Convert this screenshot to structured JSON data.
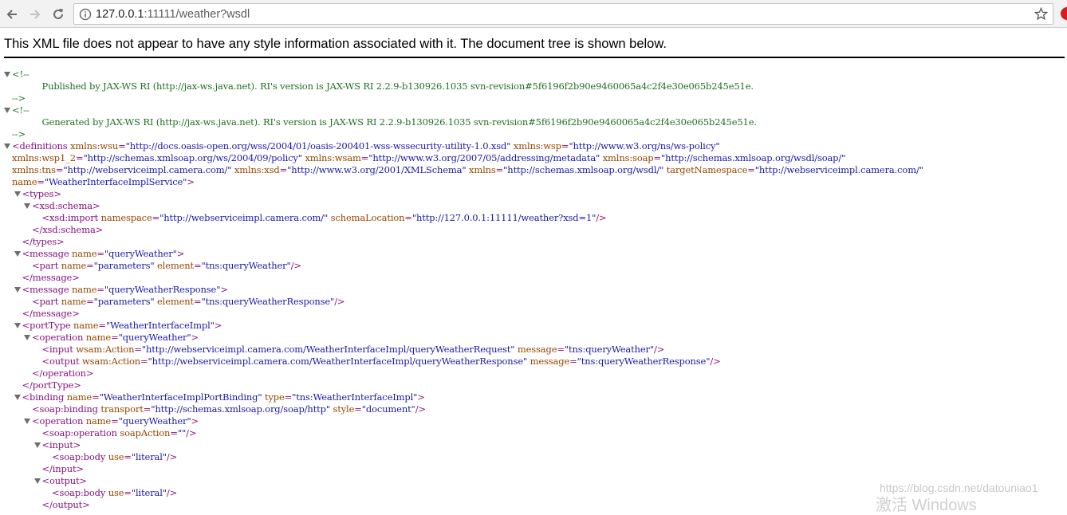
{
  "browser": {
    "url_host": "127.0.0.1",
    "url_rest": ":11111/weather?wsdl",
    "icons": {
      "back": "back-arrow-icon",
      "forward": "forward-arrow-icon",
      "reload": "reload-icon",
      "info": "page-info-icon",
      "bookmark": "bookmark-star-icon",
      "extension": "extension-icon"
    }
  },
  "banner": "This XML file does not appear to have any style information associated with it. The document tree is shown below.",
  "colors": {
    "comment": "#236e25",
    "tag": "#881280",
    "attr_name": "#994500",
    "attr_value": "#1a1aa6"
  },
  "tree": [
    {
      "indent": 0,
      "toggle": true,
      "parts": [
        {
          "c": "comment",
          "t": "<!--"
        }
      ]
    },
    {
      "indent": 3,
      "toggle": false,
      "parts": [
        {
          "c": "comment",
          "t": "Published by JAX-WS RI (http://jax-ws.java.net). RI's version is JAX-WS RI 2.2.9-b130926.1035 svn-revision#5f6196f2b90e9460065a4c2f4e30e065b245e51e."
        }
      ]
    },
    {
      "indent": 0,
      "toggle": false,
      "parts": [
        {
          "c": "comment",
          "t": "-->"
        }
      ]
    },
    {
      "indent": 0,
      "toggle": true,
      "parts": [
        {
          "c": "comment",
          "t": "<!--"
        }
      ]
    },
    {
      "indent": 3,
      "toggle": false,
      "parts": [
        {
          "c": "comment",
          "t": "Generated by JAX-WS RI (http://jax-ws.java.net). RI's version is JAX-WS RI 2.2.9-b130926.1035 svn-revision#5f6196f2b90e9460065a4c2f4e30e065b245e51e."
        }
      ]
    },
    {
      "indent": 0,
      "toggle": false,
      "parts": [
        {
          "c": "comment",
          "t": "-->"
        }
      ]
    },
    {
      "indent": 0,
      "toggle": true,
      "parts": [
        {
          "c": "tag",
          "t": "<definitions "
        },
        {
          "c": "attr",
          "t": "xmlns:wsu"
        },
        {
          "c": "tag",
          "t": "="
        },
        {
          "c": "val",
          "t": "\"http://docs.oasis-open.org/wss/2004/01/oasis-200401-wss-wssecurity-utility-1.0.xsd\""
        },
        {
          "c": "tag",
          "t": " "
        },
        {
          "c": "attr",
          "t": "xmlns:wsp"
        },
        {
          "c": "tag",
          "t": "="
        },
        {
          "c": "val",
          "t": "\"http://www.w3.org/ns/ws-policy\""
        }
      ]
    },
    {
      "indent": 0,
      "toggle": false,
      "parts": [
        {
          "c": "attr",
          "t": "xmlns:wsp1_2"
        },
        {
          "c": "tag",
          "t": "="
        },
        {
          "c": "val",
          "t": "\"http://schemas.xmlsoap.org/ws/2004/09/policy\""
        },
        {
          "c": "tag",
          "t": " "
        },
        {
          "c": "attr",
          "t": "xmlns:wsam"
        },
        {
          "c": "tag",
          "t": "="
        },
        {
          "c": "val",
          "t": "\"http://www.w3.org/2007/05/addressing/metadata\""
        },
        {
          "c": "tag",
          "t": " "
        },
        {
          "c": "attr",
          "t": "xmlns:soap"
        },
        {
          "c": "tag",
          "t": "="
        },
        {
          "c": "val",
          "t": "\"http://schemas.xmlsoap.org/wsdl/soap/\""
        }
      ]
    },
    {
      "indent": 0,
      "toggle": false,
      "parts": [
        {
          "c": "attr",
          "t": "xmlns:tns"
        },
        {
          "c": "tag",
          "t": "="
        },
        {
          "c": "val",
          "t": "\"http://webserviceimpl.camera.com/\""
        },
        {
          "c": "tag",
          "t": " "
        },
        {
          "c": "attr",
          "t": "xmlns:xsd"
        },
        {
          "c": "tag",
          "t": "="
        },
        {
          "c": "val",
          "t": "\"http://www.w3.org/2001/XMLSchema\""
        },
        {
          "c": "tag",
          "t": " "
        },
        {
          "c": "attr",
          "t": "xmlns"
        },
        {
          "c": "tag",
          "t": "="
        },
        {
          "c": "val",
          "t": "\"http://schemas.xmlsoap.org/wsdl/\""
        },
        {
          "c": "tag",
          "t": " "
        },
        {
          "c": "attr",
          "t": "targetNamespace"
        },
        {
          "c": "tag",
          "t": "="
        },
        {
          "c": "val",
          "t": "\"http://webserviceimpl.camera.com/\""
        }
      ]
    },
    {
      "indent": 0,
      "toggle": false,
      "parts": [
        {
          "c": "attr",
          "t": "name"
        },
        {
          "c": "tag",
          "t": "="
        },
        {
          "c": "val",
          "t": "\"WeatherInterfaceImplService\""
        },
        {
          "c": "tag",
          "t": ">"
        }
      ]
    },
    {
      "indent": 1,
      "toggle": true,
      "parts": [
        {
          "c": "tag",
          "t": "<types>"
        }
      ]
    },
    {
      "indent": 2,
      "toggle": true,
      "parts": [
        {
          "c": "tag",
          "t": "<xsd:schema>"
        }
      ]
    },
    {
      "indent": 3,
      "toggle": false,
      "parts": [
        {
          "c": "tag",
          "t": "<xsd:import "
        },
        {
          "c": "attr",
          "t": "namespace"
        },
        {
          "c": "tag",
          "t": "="
        },
        {
          "c": "val",
          "t": "\"http://webserviceimpl.camera.com/\""
        },
        {
          "c": "tag",
          "t": " "
        },
        {
          "c": "attr",
          "t": "schemaLocation"
        },
        {
          "c": "tag",
          "t": "="
        },
        {
          "c": "val",
          "t": "\"http://127.0.0.1:11111/weather?xsd=1\""
        },
        {
          "c": "tag",
          "t": "/>"
        }
      ]
    },
    {
      "indent": 2,
      "toggle": false,
      "parts": [
        {
          "c": "tag",
          "t": "</xsd:schema>"
        }
      ]
    },
    {
      "indent": 1,
      "toggle": false,
      "parts": [
        {
          "c": "tag",
          "t": "</types>"
        }
      ]
    },
    {
      "indent": 1,
      "toggle": true,
      "parts": [
        {
          "c": "tag",
          "t": "<message "
        },
        {
          "c": "attr",
          "t": "name"
        },
        {
          "c": "tag",
          "t": "="
        },
        {
          "c": "val",
          "t": "\"queryWeather\""
        },
        {
          "c": "tag",
          "t": ">"
        }
      ]
    },
    {
      "indent": 2,
      "toggle": false,
      "parts": [
        {
          "c": "tag",
          "t": "<part "
        },
        {
          "c": "attr",
          "t": "name"
        },
        {
          "c": "tag",
          "t": "="
        },
        {
          "c": "val",
          "t": "\"parameters\""
        },
        {
          "c": "tag",
          "t": " "
        },
        {
          "c": "attr",
          "t": "element"
        },
        {
          "c": "tag",
          "t": "="
        },
        {
          "c": "val",
          "t": "\"tns:queryWeather\""
        },
        {
          "c": "tag",
          "t": "/>"
        }
      ]
    },
    {
      "indent": 1,
      "toggle": false,
      "parts": [
        {
          "c": "tag",
          "t": "</message>"
        }
      ]
    },
    {
      "indent": 1,
      "toggle": true,
      "parts": [
        {
          "c": "tag",
          "t": "<message "
        },
        {
          "c": "attr",
          "t": "name"
        },
        {
          "c": "tag",
          "t": "="
        },
        {
          "c": "val",
          "t": "\"queryWeatherResponse\""
        },
        {
          "c": "tag",
          "t": ">"
        }
      ]
    },
    {
      "indent": 2,
      "toggle": false,
      "parts": [
        {
          "c": "tag",
          "t": "<part "
        },
        {
          "c": "attr",
          "t": "name"
        },
        {
          "c": "tag",
          "t": "="
        },
        {
          "c": "val",
          "t": "\"parameters\""
        },
        {
          "c": "tag",
          "t": " "
        },
        {
          "c": "attr",
          "t": "element"
        },
        {
          "c": "tag",
          "t": "="
        },
        {
          "c": "val",
          "t": "\"tns:queryWeatherResponse\""
        },
        {
          "c": "tag",
          "t": "/>"
        }
      ]
    },
    {
      "indent": 1,
      "toggle": false,
      "parts": [
        {
          "c": "tag",
          "t": "</message>"
        }
      ]
    },
    {
      "indent": 1,
      "toggle": true,
      "parts": [
        {
          "c": "tag",
          "t": "<portType "
        },
        {
          "c": "attr",
          "t": "name"
        },
        {
          "c": "tag",
          "t": "="
        },
        {
          "c": "val",
          "t": "\"WeatherInterfaceImpl\""
        },
        {
          "c": "tag",
          "t": ">"
        }
      ]
    },
    {
      "indent": 2,
      "toggle": true,
      "parts": [
        {
          "c": "tag",
          "t": "<operation "
        },
        {
          "c": "attr",
          "t": "name"
        },
        {
          "c": "tag",
          "t": "="
        },
        {
          "c": "val",
          "t": "\"queryWeather\""
        },
        {
          "c": "tag",
          "t": ">"
        }
      ]
    },
    {
      "indent": 3,
      "toggle": false,
      "parts": [
        {
          "c": "tag",
          "t": "<input "
        },
        {
          "c": "attr",
          "t": "wsam:Action"
        },
        {
          "c": "tag",
          "t": "="
        },
        {
          "c": "val",
          "t": "\"http://webserviceimpl.camera.com/WeatherInterfaceImpl/queryWeatherRequest\""
        },
        {
          "c": "tag",
          "t": " "
        },
        {
          "c": "attr",
          "t": "message"
        },
        {
          "c": "tag",
          "t": "="
        },
        {
          "c": "val",
          "t": "\"tns:queryWeather\""
        },
        {
          "c": "tag",
          "t": "/>"
        }
      ]
    },
    {
      "indent": 3,
      "toggle": false,
      "parts": [
        {
          "c": "tag",
          "t": "<output "
        },
        {
          "c": "attr",
          "t": "wsam:Action"
        },
        {
          "c": "tag",
          "t": "="
        },
        {
          "c": "val",
          "t": "\"http://webserviceimpl.camera.com/WeatherInterfaceImpl/queryWeatherResponse\""
        },
        {
          "c": "tag",
          "t": " "
        },
        {
          "c": "attr",
          "t": "message"
        },
        {
          "c": "tag",
          "t": "="
        },
        {
          "c": "val",
          "t": "\"tns:queryWeatherResponse\""
        },
        {
          "c": "tag",
          "t": "/>"
        }
      ]
    },
    {
      "indent": 2,
      "toggle": false,
      "parts": [
        {
          "c": "tag",
          "t": "</operation>"
        }
      ]
    },
    {
      "indent": 1,
      "toggle": false,
      "parts": [
        {
          "c": "tag",
          "t": "</portType>"
        }
      ]
    },
    {
      "indent": 1,
      "toggle": true,
      "parts": [
        {
          "c": "tag",
          "t": "<binding "
        },
        {
          "c": "attr",
          "t": "name"
        },
        {
          "c": "tag",
          "t": "="
        },
        {
          "c": "val",
          "t": "\"WeatherInterfaceImplPortBinding\""
        },
        {
          "c": "tag",
          "t": " "
        },
        {
          "c": "attr",
          "t": "type"
        },
        {
          "c": "tag",
          "t": "="
        },
        {
          "c": "val",
          "t": "\"tns:WeatherInterfaceImpl\""
        },
        {
          "c": "tag",
          "t": ">"
        }
      ]
    },
    {
      "indent": 2,
      "toggle": false,
      "parts": [
        {
          "c": "tag",
          "t": "<soap:binding "
        },
        {
          "c": "attr",
          "t": "transport"
        },
        {
          "c": "tag",
          "t": "="
        },
        {
          "c": "val",
          "t": "\"http://schemas.xmlsoap.org/soap/http\""
        },
        {
          "c": "tag",
          "t": " "
        },
        {
          "c": "attr",
          "t": "style"
        },
        {
          "c": "tag",
          "t": "="
        },
        {
          "c": "val",
          "t": "\"document\""
        },
        {
          "c": "tag",
          "t": "/>"
        }
      ]
    },
    {
      "indent": 2,
      "toggle": true,
      "parts": [
        {
          "c": "tag",
          "t": "<operation "
        },
        {
          "c": "attr",
          "t": "name"
        },
        {
          "c": "tag",
          "t": "="
        },
        {
          "c": "val",
          "t": "\"queryWeather\""
        },
        {
          "c": "tag",
          "t": ">"
        }
      ]
    },
    {
      "indent": 3,
      "toggle": false,
      "parts": [
        {
          "c": "tag",
          "t": "<soap:operation "
        },
        {
          "c": "attr",
          "t": "soapAction"
        },
        {
          "c": "tag",
          "t": "="
        },
        {
          "c": "val",
          "t": "\"\""
        },
        {
          "c": "tag",
          "t": "/>"
        }
      ]
    },
    {
      "indent": 3,
      "toggle": true,
      "parts": [
        {
          "c": "tag",
          "t": "<input>"
        }
      ]
    },
    {
      "indent": 4,
      "toggle": false,
      "parts": [
        {
          "c": "tag",
          "t": "<soap:body "
        },
        {
          "c": "attr",
          "t": "use"
        },
        {
          "c": "tag",
          "t": "="
        },
        {
          "c": "val",
          "t": "\"literal\""
        },
        {
          "c": "tag",
          "t": "/>"
        }
      ]
    },
    {
      "indent": 3,
      "toggle": false,
      "parts": [
        {
          "c": "tag",
          "t": "</input>"
        }
      ]
    },
    {
      "indent": 3,
      "toggle": true,
      "parts": [
        {
          "c": "tag",
          "t": "<output>"
        }
      ]
    },
    {
      "indent": 4,
      "toggle": false,
      "parts": [
        {
          "c": "tag",
          "t": "<soap:body "
        },
        {
          "c": "attr",
          "t": "use"
        },
        {
          "c": "tag",
          "t": "="
        },
        {
          "c": "val",
          "t": "\"literal\""
        },
        {
          "c": "tag",
          "t": "/>"
        }
      ]
    },
    {
      "indent": 3,
      "toggle": false,
      "parts": [
        {
          "c": "tag",
          "t": "</output>"
        }
      ]
    }
  ],
  "watermark": {
    "source": "https://blog.csdn.net/datouniao1",
    "os": "激活 Windows"
  }
}
